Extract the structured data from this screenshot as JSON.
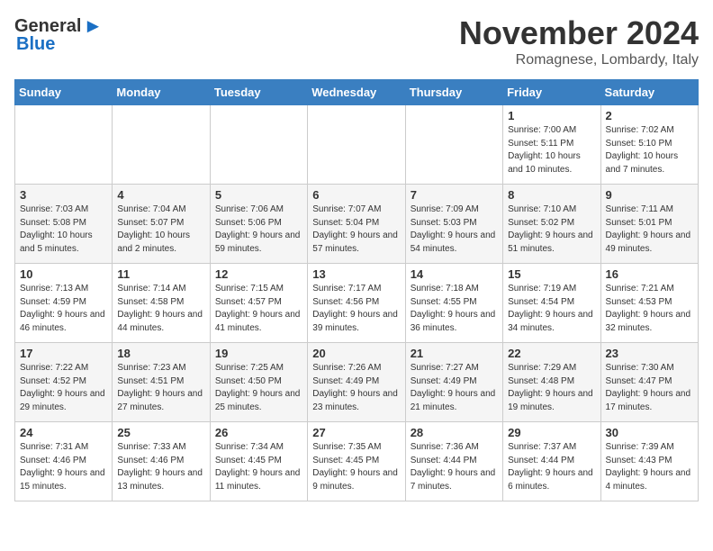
{
  "header": {
    "logo_general": "General",
    "logo_blue": "Blue",
    "month_title": "November 2024",
    "location": "Romagnese, Lombardy, Italy"
  },
  "days_of_week": [
    "Sunday",
    "Monday",
    "Tuesday",
    "Wednesday",
    "Thursday",
    "Friday",
    "Saturday"
  ],
  "weeks": [
    [
      {
        "day": "",
        "info": ""
      },
      {
        "day": "",
        "info": ""
      },
      {
        "day": "",
        "info": ""
      },
      {
        "day": "",
        "info": ""
      },
      {
        "day": "",
        "info": ""
      },
      {
        "day": "1",
        "info": "Sunrise: 7:00 AM\nSunset: 5:11 PM\nDaylight: 10 hours\nand 10 minutes."
      },
      {
        "day": "2",
        "info": "Sunrise: 7:02 AM\nSunset: 5:10 PM\nDaylight: 10 hours\nand 7 minutes."
      }
    ],
    [
      {
        "day": "3",
        "info": "Sunrise: 7:03 AM\nSunset: 5:08 PM\nDaylight: 10 hours\nand 5 minutes."
      },
      {
        "day": "4",
        "info": "Sunrise: 7:04 AM\nSunset: 5:07 PM\nDaylight: 10 hours\nand 2 minutes."
      },
      {
        "day": "5",
        "info": "Sunrise: 7:06 AM\nSunset: 5:06 PM\nDaylight: 9 hours\nand 59 minutes."
      },
      {
        "day": "6",
        "info": "Sunrise: 7:07 AM\nSunset: 5:04 PM\nDaylight: 9 hours\nand 57 minutes."
      },
      {
        "day": "7",
        "info": "Sunrise: 7:09 AM\nSunset: 5:03 PM\nDaylight: 9 hours\nand 54 minutes."
      },
      {
        "day": "8",
        "info": "Sunrise: 7:10 AM\nSunset: 5:02 PM\nDaylight: 9 hours\nand 51 minutes."
      },
      {
        "day": "9",
        "info": "Sunrise: 7:11 AM\nSunset: 5:01 PM\nDaylight: 9 hours\nand 49 minutes."
      }
    ],
    [
      {
        "day": "10",
        "info": "Sunrise: 7:13 AM\nSunset: 4:59 PM\nDaylight: 9 hours\nand 46 minutes."
      },
      {
        "day": "11",
        "info": "Sunrise: 7:14 AM\nSunset: 4:58 PM\nDaylight: 9 hours\nand 44 minutes."
      },
      {
        "day": "12",
        "info": "Sunrise: 7:15 AM\nSunset: 4:57 PM\nDaylight: 9 hours\nand 41 minutes."
      },
      {
        "day": "13",
        "info": "Sunrise: 7:17 AM\nSunset: 4:56 PM\nDaylight: 9 hours\nand 39 minutes."
      },
      {
        "day": "14",
        "info": "Sunrise: 7:18 AM\nSunset: 4:55 PM\nDaylight: 9 hours\nand 36 minutes."
      },
      {
        "day": "15",
        "info": "Sunrise: 7:19 AM\nSunset: 4:54 PM\nDaylight: 9 hours\nand 34 minutes."
      },
      {
        "day": "16",
        "info": "Sunrise: 7:21 AM\nSunset: 4:53 PM\nDaylight: 9 hours\nand 32 minutes."
      }
    ],
    [
      {
        "day": "17",
        "info": "Sunrise: 7:22 AM\nSunset: 4:52 PM\nDaylight: 9 hours\nand 29 minutes."
      },
      {
        "day": "18",
        "info": "Sunrise: 7:23 AM\nSunset: 4:51 PM\nDaylight: 9 hours\nand 27 minutes."
      },
      {
        "day": "19",
        "info": "Sunrise: 7:25 AM\nSunset: 4:50 PM\nDaylight: 9 hours\nand 25 minutes."
      },
      {
        "day": "20",
        "info": "Sunrise: 7:26 AM\nSunset: 4:49 PM\nDaylight: 9 hours\nand 23 minutes."
      },
      {
        "day": "21",
        "info": "Sunrise: 7:27 AM\nSunset: 4:49 PM\nDaylight: 9 hours\nand 21 minutes."
      },
      {
        "day": "22",
        "info": "Sunrise: 7:29 AM\nSunset: 4:48 PM\nDaylight: 9 hours\nand 19 minutes."
      },
      {
        "day": "23",
        "info": "Sunrise: 7:30 AM\nSunset: 4:47 PM\nDaylight: 9 hours\nand 17 minutes."
      }
    ],
    [
      {
        "day": "24",
        "info": "Sunrise: 7:31 AM\nSunset: 4:46 PM\nDaylight: 9 hours\nand 15 minutes."
      },
      {
        "day": "25",
        "info": "Sunrise: 7:33 AM\nSunset: 4:46 PM\nDaylight: 9 hours\nand 13 minutes."
      },
      {
        "day": "26",
        "info": "Sunrise: 7:34 AM\nSunset: 4:45 PM\nDaylight: 9 hours\nand 11 minutes."
      },
      {
        "day": "27",
        "info": "Sunrise: 7:35 AM\nSunset: 4:45 PM\nDaylight: 9 hours\nand 9 minutes."
      },
      {
        "day": "28",
        "info": "Sunrise: 7:36 AM\nSunset: 4:44 PM\nDaylight: 9 hours\nand 7 minutes."
      },
      {
        "day": "29",
        "info": "Sunrise: 7:37 AM\nSunset: 4:44 PM\nDaylight: 9 hours\nand 6 minutes."
      },
      {
        "day": "30",
        "info": "Sunrise: 7:39 AM\nSunset: 4:43 PM\nDaylight: 9 hours\nand 4 minutes."
      }
    ]
  ]
}
